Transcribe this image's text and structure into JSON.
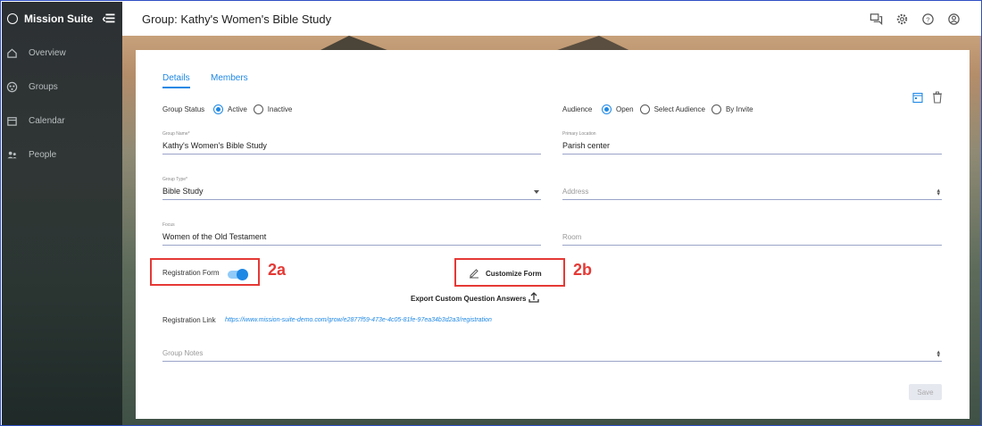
{
  "sidebar": {
    "brand": "Mission Suite",
    "items": [
      {
        "label": "Overview",
        "icon": "home-icon"
      },
      {
        "label": "Groups",
        "icon": "groups-icon"
      },
      {
        "label": "Calendar",
        "icon": "calendar-icon"
      },
      {
        "label": "People",
        "icon": "people-icon"
      }
    ]
  },
  "header": {
    "title": "Group: Kathy's Women's Bible Study",
    "icons": [
      "chat-icon",
      "gear-icon",
      "help-icon",
      "account-icon"
    ]
  },
  "tabs": [
    "Details",
    "Members"
  ],
  "group_status": {
    "label": "Group Status",
    "options": [
      "Active",
      "Inactive"
    ],
    "selected": "Active"
  },
  "audience": {
    "label": "Audience",
    "options": [
      "Open",
      "Select Audience",
      "By Invite"
    ],
    "selected": "Open"
  },
  "fields": {
    "group_name": {
      "label": "Group Name*",
      "value": "Kathy's Women's Bible Study"
    },
    "primary_location": {
      "label": "Primary Location",
      "value": "Parish center"
    },
    "group_type": {
      "label": "Group Type*",
      "value": "Bible Study"
    },
    "address": {
      "placeholder": "Address"
    },
    "focus": {
      "label": "Focus",
      "value": "Women of the Old Testament"
    },
    "room": {
      "placeholder": "Room"
    },
    "group_notes": {
      "placeholder": "Group Notes"
    }
  },
  "registration": {
    "form_label": "Registration Form",
    "form_enabled": true,
    "customize_label": "Customize Form",
    "export_label": "Export Custom Question Answers",
    "link_label": "Registration Link",
    "link_url": "https://www.mission-suite-demo.com/grow/e2877f59-473e-4c05-81fe-97ea34b3d2a3/registration"
  },
  "callouts": {
    "a": "2a",
    "b": "2b"
  },
  "save_label": "Save",
  "colors": {
    "accent": "#1e88e5",
    "callout": "#e53935",
    "sidebar": "#2c3033"
  }
}
